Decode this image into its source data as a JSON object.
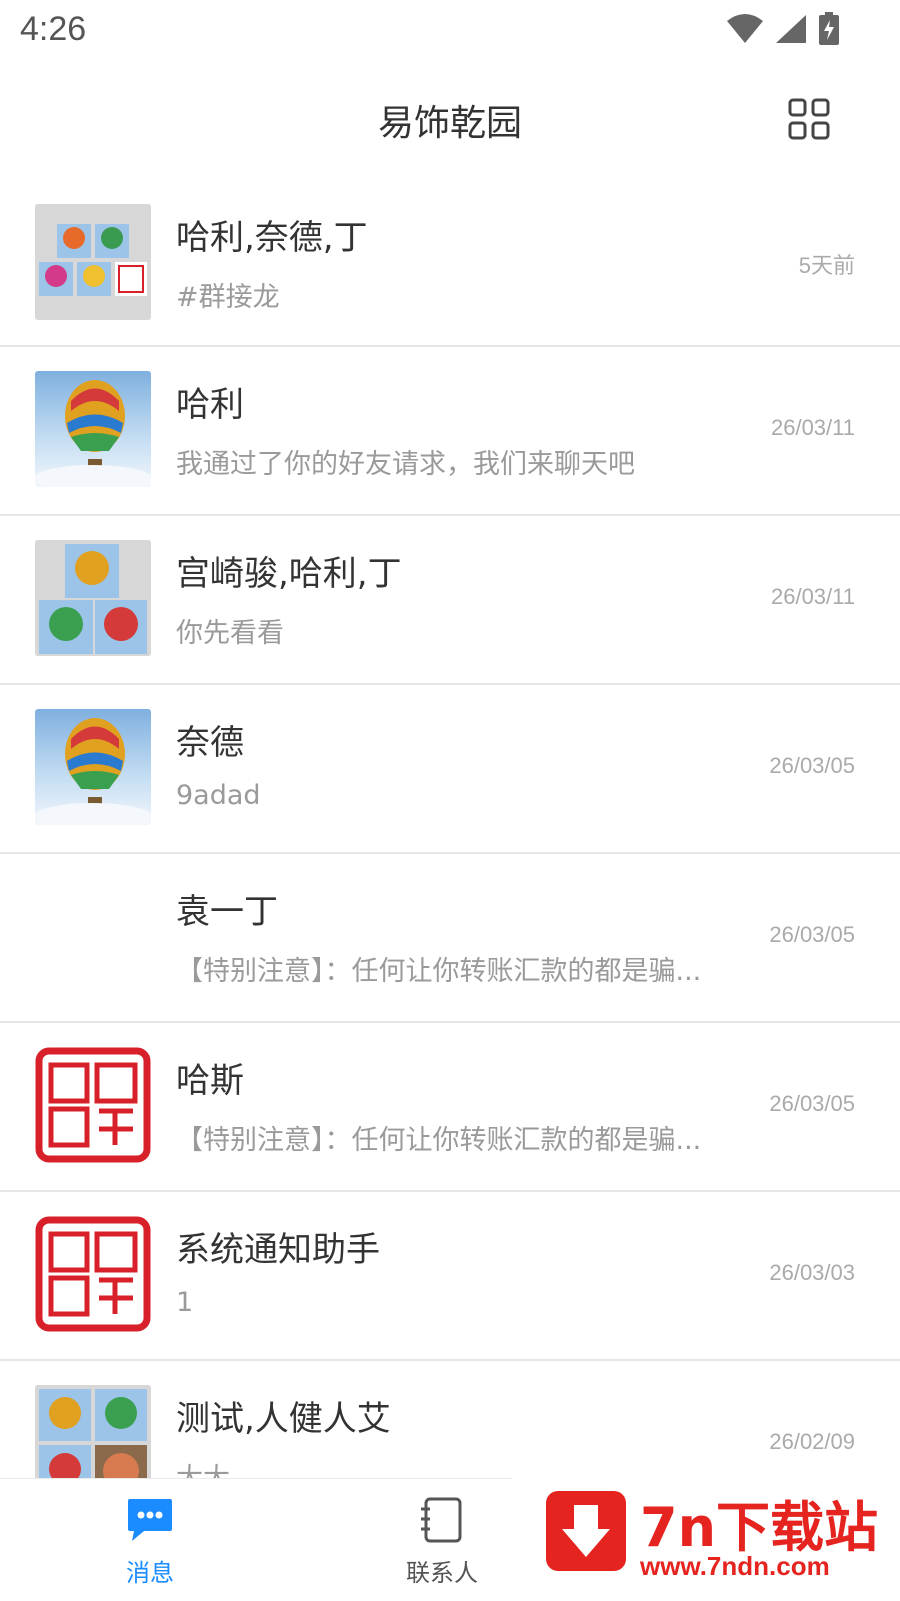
{
  "status_bar": {
    "time": "4:26"
  },
  "header": {
    "title": "易饰乾园",
    "grid_icon": "grid-icon"
  },
  "conversations": [
    {
      "name": "哈利,奈德,丁",
      "preview": "#群接龙",
      "time": "5天前",
      "avatar": "group-collage"
    },
    {
      "name": "哈利",
      "preview": "我通过了你的好友请求，我们来聊天吧",
      "time": "26/03/11",
      "avatar": "balloon"
    },
    {
      "name": "宫崎骏,哈利,丁",
      "preview": "你先看看",
      "time": "26/03/11",
      "avatar": "group-collage"
    },
    {
      "name": "奈德",
      "preview": "9adad",
      "time": "26/03/05",
      "avatar": "balloon"
    },
    {
      "name": "袁一丁",
      "preview": "【特别注意】：任何让你转账汇款的都是骗...",
      "time": "26/03/05",
      "avatar": "none"
    },
    {
      "name": "哈斯",
      "preview": "【特别注意】：任何让你转账汇款的都是骗...",
      "time": "26/03/05",
      "avatar": "seal"
    },
    {
      "name": "系统通知助手",
      "preview": "1",
      "time": "26/03/03",
      "avatar": "seal"
    },
    {
      "name": "测试,人健人艾",
      "preview": "大大",
      "time": "26/02/09",
      "avatar": "group-collage"
    }
  ],
  "tabs": [
    {
      "label": "消息",
      "icon": "chat-icon",
      "active": true
    },
    {
      "label": "联系人",
      "icon": "contacts-icon",
      "active": false
    }
  ],
  "watermark": {
    "title": "7n下载站",
    "url": "www.7ndn.com"
  },
  "colors": {
    "accent": "#1a8cff",
    "text": "#333333",
    "muted": "#9a9a9a",
    "seal_red": "#d8202a"
  }
}
